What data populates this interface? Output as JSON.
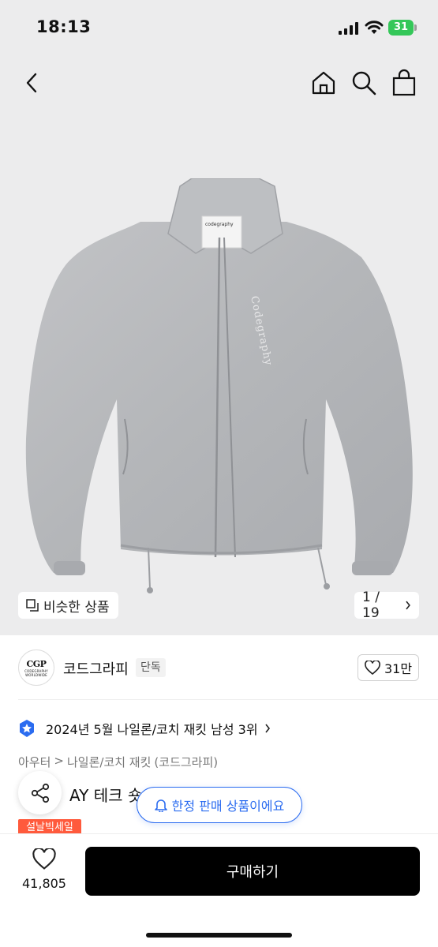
{
  "status_bar": {
    "time": "18:13",
    "battery": "31"
  },
  "gallery": {
    "similar_label": "비슷한 상품",
    "page_indicator": "1 / 19",
    "jacket_label": "codegraphy"
  },
  "brand": {
    "name": "코드그라피",
    "badge": "단독",
    "logo_text": "CGP",
    "logo_subtext": "CODEGRAPHY WORLDWIDE",
    "like_count": "31만"
  },
  "ranking": {
    "text": "2024년 5월 나일론/코치 재킷 남성 3위"
  },
  "category": {
    "parts": [
      "아우터",
      ">",
      "나일론/코치 재킷",
      "(코드그라피)"
    ]
  },
  "product": {
    "title_visible": "AY 테크 숏",
    "limited_notice": "한정 판매 상품이에요",
    "sale_badge": "설날빅세일"
  },
  "bottom_bar": {
    "heart_count": "41,805",
    "buy_label": "구매하기"
  },
  "colors": {
    "accent_blue": "#2b6cf0",
    "sale_red": "#ff5a3c",
    "buy_black": "#000000",
    "battery_green": "#34c759"
  }
}
